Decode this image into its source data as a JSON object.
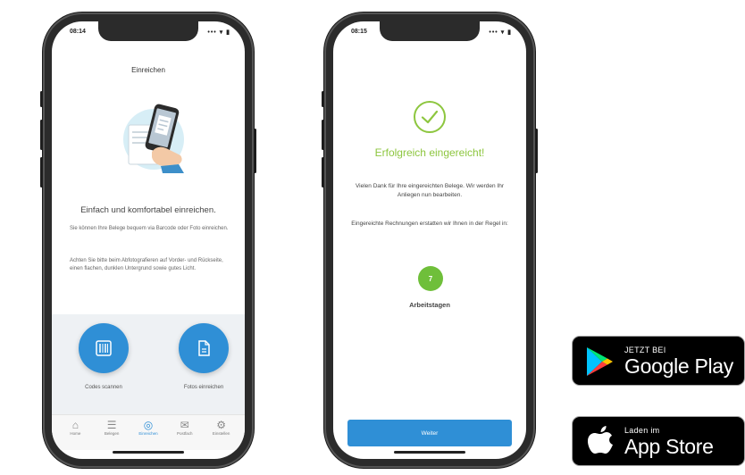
{
  "phone_left": {
    "status_time": "08:14",
    "status_icons": "••• ▾ ▮",
    "title": "Einreichen",
    "heading": "Einfach und komfortabel einreichen.",
    "paragraph_1": "Sie können Ihre Belege bequem via Barcode oder Foto einreichen.",
    "paragraph_2": "Achten Sie bitte beim Abfotografieren auf Vorder- und Rückseite, einen flachen, dunklen Untergrund sowie gutes Licht.",
    "button_left_label": "Codes scannen",
    "button_right_label": "Fotos einreichen",
    "tabs": [
      {
        "label": "Home",
        "icon": "home-icon",
        "glyph": "⌂"
      },
      {
        "label": "Belegen",
        "icon": "documents-icon",
        "glyph": "☰"
      },
      {
        "label": "Einreichen",
        "icon": "camera-icon",
        "glyph": "◎"
      },
      {
        "label": "Postfach",
        "icon": "mail-icon",
        "glyph": "✉"
      },
      {
        "label": "Einstellen",
        "icon": "settings-icon",
        "glyph": "⚙"
      }
    ],
    "active_tab": 2
  },
  "phone_right": {
    "status_time": "08:15",
    "status_icons": "••• ▾ ▮",
    "success_title": "Erfolgreich eingereicht!",
    "paragraph_1": "Vielen Dank für Ihre eingereichten Belege. Wir werden Ihr Anliegen nun bearbeiten.",
    "paragraph_2": "Eingereichte Rechnungen erstatten wir Ihnen in der Regel in:",
    "days_value": "7",
    "days_label": "Arbeitstagen",
    "button_label": "Weiter"
  },
  "google_badge": {
    "small_text": "JETZT BEI",
    "big_text": "Google Play"
  },
  "apple_badge": {
    "small_text": "Laden im",
    "big_text": "App Store"
  },
  "colors": {
    "accent_blue": "#2f8fd6",
    "success_green": "#8dc63f",
    "days_green": "#6fbf3a"
  }
}
